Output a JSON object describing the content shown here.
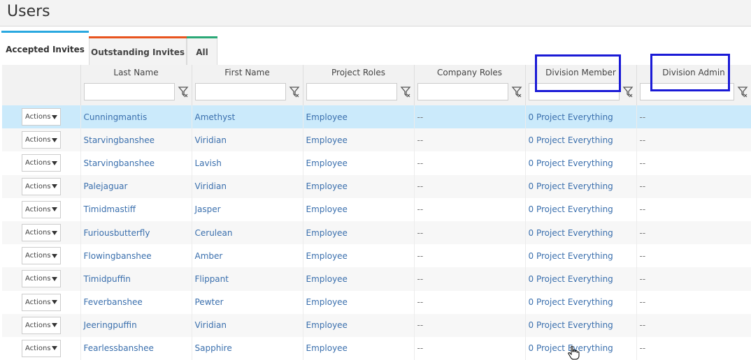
{
  "page": {
    "title": "Users"
  },
  "tabs": [
    {
      "label": "Accepted Invites",
      "accent": "#29a8e0"
    },
    {
      "label": "Outstanding Invites",
      "accent": "#e8541e"
    },
    {
      "label": "All",
      "accent": "#2aa876"
    }
  ],
  "columns": [
    {
      "label": "Last Name"
    },
    {
      "label": "First Name"
    },
    {
      "label": "Project Roles"
    },
    {
      "label": "Company Roles"
    },
    {
      "label": "Division Member"
    },
    {
      "label": "Division Admin"
    }
  ],
  "filters": {
    "placeholder": ""
  },
  "actions_label": "Actions",
  "rows": [
    {
      "last": "Cunningmantis",
      "first": "Amethyst",
      "project_roles": "Employee",
      "company_roles": "--",
      "division_member": "0 Project Everything",
      "division_admin": "--"
    },
    {
      "last": "Starvingbanshee",
      "first": "Viridian",
      "project_roles": "Employee",
      "company_roles": "--",
      "division_member": "0 Project Everything",
      "division_admin": "--"
    },
    {
      "last": "Starvingbanshee",
      "first": "Lavish",
      "project_roles": "Employee",
      "company_roles": "--",
      "division_member": "0 Project Everything",
      "division_admin": "--"
    },
    {
      "last": "Palejaguar",
      "first": "Viridian",
      "project_roles": "Employee",
      "company_roles": "--",
      "division_member": "0 Project Everything",
      "division_admin": "--"
    },
    {
      "last": "Timidmastiff",
      "first": "Jasper",
      "project_roles": "Employee",
      "company_roles": "--",
      "division_member": "0 Project Everything",
      "division_admin": "--"
    },
    {
      "last": "Furiousbutterfly",
      "first": "Cerulean",
      "project_roles": "Employee",
      "company_roles": "--",
      "division_member": "0 Project Everything",
      "division_admin": "--"
    },
    {
      "last": "Flowingbanshee",
      "first": "Amber",
      "project_roles": "Employee",
      "company_roles": "--",
      "division_member": "0 Project Everything",
      "division_admin": "--"
    },
    {
      "last": "Timidpuffin",
      "first": "Flippant",
      "project_roles": "Employee",
      "company_roles": "--",
      "division_member": "0 Project Everything",
      "division_admin": "--"
    },
    {
      "last": "Feverbanshee",
      "first": "Pewter",
      "project_roles": "Employee",
      "company_roles": "--",
      "division_member": "0 Project Everything",
      "division_admin": "--"
    },
    {
      "last": "Jeeringpuffin",
      "first": "Viridian",
      "project_roles": "Employee",
      "company_roles": "--",
      "division_member": "0 Project Everything",
      "division_admin": "--"
    },
    {
      "last": "Fearlessbanshee",
      "first": "Sapphire",
      "project_roles": "Employee",
      "company_roles": "--",
      "division_member": "0 Project Everything",
      "division_admin": "--"
    }
  ],
  "colors": {
    "link": "#3a6fad",
    "selected_row": "#cbeafb",
    "highlight": "#1a1ad6"
  },
  "icons": {
    "filter": "funnel-icon",
    "actions_caret": "caret-down-icon",
    "cursor": "hand-pointer-icon"
  }
}
